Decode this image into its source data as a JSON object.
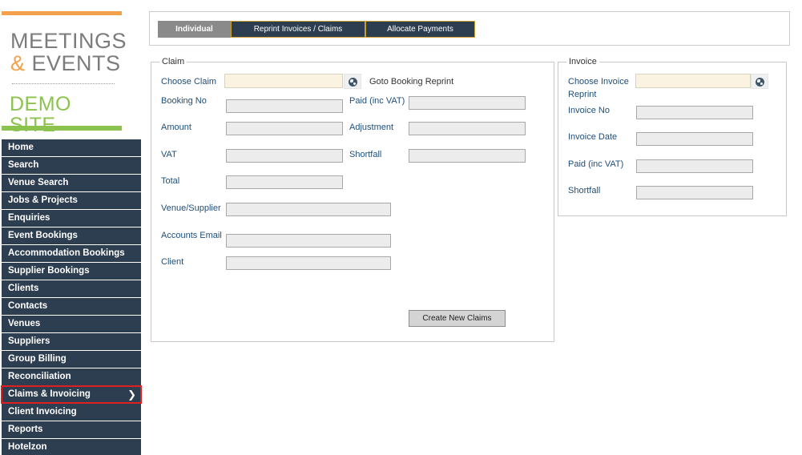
{
  "logo": {
    "line1": "MEETINGS",
    "line2_amp": "&",
    "line2_rest": " EVENTS",
    "subtitle": "DEMO SITE",
    "colors": {
      "orange": "#f5a04a",
      "green": "#8cc34f",
      "grey": "#7c7c7c"
    }
  },
  "nav": {
    "items": [
      "Home",
      "Search",
      "Venue Search",
      "Jobs & Projects",
      "Enquiries",
      "Event Bookings",
      "Accommodation Bookings",
      "Supplier Bookings",
      "Clients",
      "Contacts",
      "Venues",
      "Suppliers",
      "Group Billing",
      "Reconciliation",
      "Claims & Invoicing",
      "Client Invoicing",
      "Reports",
      "Hotelzon"
    ],
    "active": "Claims & Invoicing",
    "active_icon": "chevron-right-icon"
  },
  "tabs": {
    "individual": "Individual",
    "reprint": "Reprint Invoices / Claims",
    "allocate": "Allocate Payments"
  },
  "claim": {
    "legend": "Claim",
    "choose_claim_label": "Choose Claim",
    "choose_claim_value": "",
    "goto_booking": "Goto Booking Reprint",
    "booking_no_label": "Booking No",
    "booking_no_value": "",
    "paid_label": "Paid (inc VAT)",
    "paid_value": "",
    "amount_label": "Amount",
    "amount_value": "",
    "adjustment_label": "Adjustment",
    "adjustment_value": "",
    "vat_label": "VAT",
    "vat_value": "",
    "shortfall_label": "Shortfall",
    "shortfall_value": "",
    "total_label": "Total",
    "total_value": "",
    "venue_label": "Venue/Supplier",
    "venue_value": "",
    "email_label": "Accounts Email",
    "email_value": "",
    "client_label": "Client",
    "client_value": "",
    "create_button": "Create New Claims"
  },
  "invoice": {
    "legend": "Invoice",
    "choose_label_1": "Choose Invoice",
    "choose_label_2": "Reprint",
    "choose_value": "",
    "invoice_no_label": "Invoice No",
    "invoice_no_value": "",
    "invoice_date_label": "Invoice Date",
    "invoice_date_value": "",
    "paid_label": "Paid (inc VAT)",
    "paid_value": "",
    "shortfall_label": "Shortfall",
    "shortfall_value": ""
  }
}
